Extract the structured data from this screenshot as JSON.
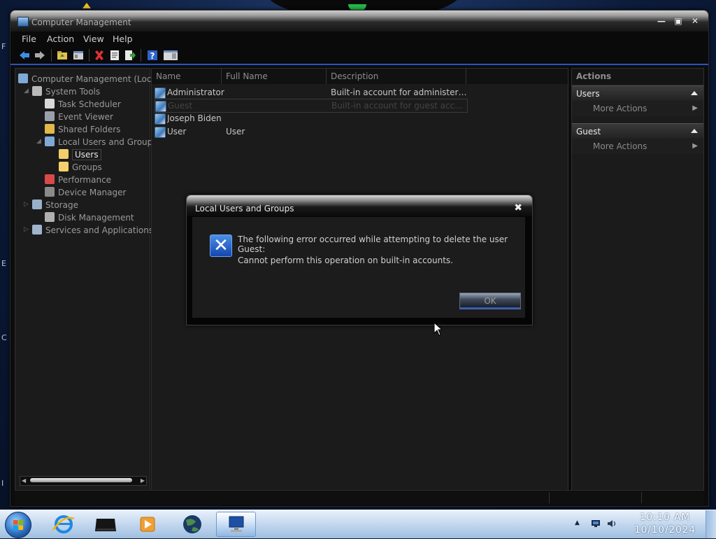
{
  "window": {
    "title": "Computer Management",
    "menu": [
      "File",
      "Action",
      "View",
      "Help"
    ],
    "controls": {
      "minimize": "—",
      "maximize": "▣",
      "close": "✕"
    }
  },
  "tree": {
    "items": [
      {
        "label": "Computer Management (Local",
        "icon": "computer-management-icon",
        "color": "#7fa9d6"
      },
      {
        "label": "System Tools",
        "icon": "tools-icon",
        "color": "#b9b9b9"
      },
      {
        "label": "Task Scheduler",
        "icon": "clock-icon",
        "color": "#d8d8d8"
      },
      {
        "label": "Event Viewer",
        "icon": "event-viewer-icon",
        "color": "#9aa0aa"
      },
      {
        "label": "Shared Folders",
        "icon": "shared-folder-icon",
        "color": "#e2b84a"
      },
      {
        "label": "Local Users and Groups",
        "icon": "users-icon",
        "color": "#7fa9d6"
      },
      {
        "label": "Users",
        "icon": "folder-icon",
        "color": "#f2d06b"
      },
      {
        "label": "Groups",
        "icon": "folder-icon",
        "color": "#f2d06b"
      },
      {
        "label": "Performance",
        "icon": "performance-icon",
        "color": "#d84a4a"
      },
      {
        "label": "Device Manager",
        "icon": "device-manager-icon",
        "color": "#8a8a8a"
      },
      {
        "label": "Storage",
        "icon": "storage-icon",
        "color": "#9ab0c8"
      },
      {
        "label": "Disk Management",
        "icon": "disk-icon",
        "color": "#b0b0b0"
      },
      {
        "label": "Services and Applications",
        "icon": "services-icon",
        "color": "#a0b4cc"
      }
    ]
  },
  "list": {
    "columns": [
      "Name",
      "Full Name",
      "Description"
    ],
    "rows": [
      {
        "name": "Administrator",
        "full_name": "",
        "description": "Built-in account for administerin..."
      },
      {
        "name": "Guest",
        "full_name": "",
        "description": "Built-in account for guest access ..."
      },
      {
        "name": "Joseph Biden",
        "full_name": "",
        "description": ""
      },
      {
        "name": "User",
        "full_name": "User",
        "description": ""
      }
    ]
  },
  "actions": {
    "header": "Actions",
    "sections": [
      {
        "title": "Users",
        "item": "More Actions"
      },
      {
        "title": "Guest",
        "item": "More Actions"
      }
    ]
  },
  "dialog": {
    "title": "Local Users and Groups",
    "message_line1": "The following error occurred while attempting to delete the user Guest:",
    "message_line2": "Cannot perform this operation on built-in accounts.",
    "ok_label": "OK",
    "close": "✖"
  },
  "taskbar": {
    "time": "10:10 AM",
    "date": "10/10/2024",
    "apps": [
      "internet-explorer-icon",
      "media-device-icon",
      "media-player-icon",
      "globe-icon",
      "computer-management-icon"
    ]
  },
  "desktop": {
    "edge_letters": [
      "F",
      "E",
      "C",
      "I"
    ]
  },
  "colors": {
    "accent": "#2754c4",
    "error": "#1446b0"
  }
}
